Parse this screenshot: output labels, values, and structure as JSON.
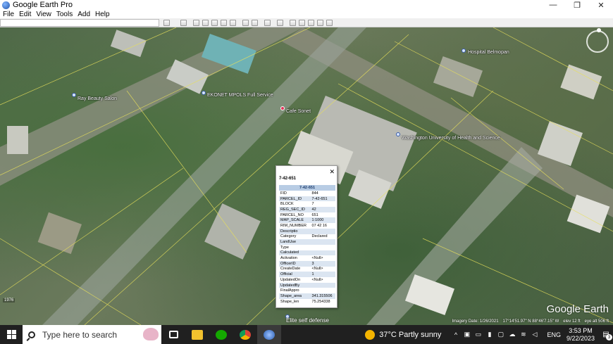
{
  "window": {
    "title": "Google Earth Pro",
    "minimize_icon": "—",
    "maximize_icon": "❐",
    "close_icon": "✕"
  },
  "menu": [
    {
      "label": "File",
      "key": "F"
    },
    {
      "label": "Edit",
      "key": "E"
    },
    {
      "label": "View",
      "key": "V"
    },
    {
      "label": "Tools",
      "key": "T"
    },
    {
      "label": "Add",
      "key": "A"
    },
    {
      "label": "Help",
      "key": "H"
    }
  ],
  "map": {
    "places": [
      {
        "label": "Ray Beauty Salon",
        "icon": "pin-icon"
      },
      {
        "label": "EKONET MPOLS Full Service",
        "icon": "pin-icon"
      },
      {
        "label": "Cafe Sonet",
        "icon": "pin-icon"
      },
      {
        "label": "Washington University of Health and Science",
        "icon": "pin-icon"
      },
      {
        "label": "Hospital Belmopan",
        "icon": "pin-icon"
      },
      {
        "label": "Elite self defense",
        "icon": "pin-icon"
      }
    ],
    "logo": "Google Earth",
    "status": {
      "imagery_date": "Imagery Date: 1/26/2021",
      "coords": "17°14'51.97\" N   88°46'7.15\" W",
      "elev": "elev 12 ft",
      "eye_alt": "eye alt 506 ft"
    },
    "scale": "1976"
  },
  "popup": {
    "title": "7-42-651",
    "close": "✕",
    "table_header": "7-42-651",
    "rows": [
      {
        "key": "FID",
        "value": "844"
      },
      {
        "key": "PARCEL_ID",
        "value": "7-42-651"
      },
      {
        "key": "BLOCK",
        "value": "7"
      },
      {
        "key": "REG_SEC_ID",
        "value": "42"
      },
      {
        "key": "PARCEL_NO",
        "value": "651"
      },
      {
        "key": "MAP_SCALE",
        "value": "1:1000"
      },
      {
        "key": "RIM_NUMBER",
        "value": "07 42 16"
      },
      {
        "key": "Descriptio",
        "value": ""
      },
      {
        "key": "Category",
        "value": "Declared"
      },
      {
        "key": "LandUse",
        "value": ""
      },
      {
        "key": "Type",
        "value": ""
      },
      {
        "key": "Calculated",
        "value": ""
      },
      {
        "key": "Activation",
        "value": "<Null>"
      },
      {
        "key": "OfficerID",
        "value": "3"
      },
      {
        "key": "CreateDate",
        "value": "<Null>"
      },
      {
        "key": "Official",
        "value": "1"
      },
      {
        "key": "UpdatedOn",
        "value": "<Null>"
      },
      {
        "key": "UpdatedBy",
        "value": ""
      },
      {
        "key": "FinalAppro",
        "value": ""
      },
      {
        "key": "Shape_area",
        "value": "341.315506"
      },
      {
        "key": "Shape_len",
        "value": "75.254338"
      }
    ]
  },
  "taskbar": {
    "search_placeholder": "Type here to search",
    "weather": "37°C  Partly sunny",
    "language": "ENG",
    "time": "3:53 PM",
    "date": "9/22/2023",
    "notifications": "3",
    "apps": [
      "task-view-icon",
      "file-explorer-icon",
      "upwork-icon",
      "chrome-icon",
      "google-earth-icon"
    ]
  }
}
